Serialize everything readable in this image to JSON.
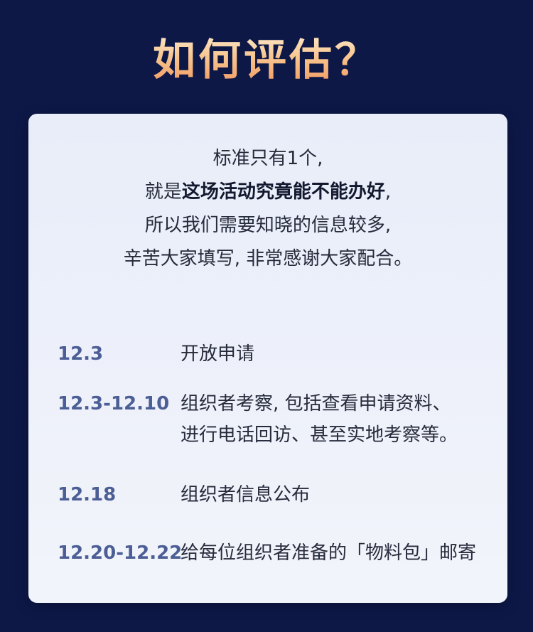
{
  "title": "如何评估？",
  "intro": {
    "line1": "标准只有1个,",
    "line2_prefix": "就是",
    "line2_bold": "这场活动究竟能不能办好",
    "line2_suffix": ",",
    "line3": "所以我们需要知晓的信息较多,",
    "line4": "辛苦大家填写, 非常感谢大家配合。"
  },
  "timeline": [
    {
      "date": "12.3",
      "lines": [
        "开放申请"
      ]
    },
    {
      "date": "12.3-12.10",
      "lines": [
        "组织者考察, 包括查看申请资料、",
        "进行电话回访、甚至实地考察等。"
      ]
    },
    {
      "date": "12.18",
      "lines": [
        "组织者信息公布"
      ]
    },
    {
      "date": "12.20-12.22",
      "lines": [
        "给每位组织者准备的「物料包」邮寄"
      ]
    }
  ]
}
